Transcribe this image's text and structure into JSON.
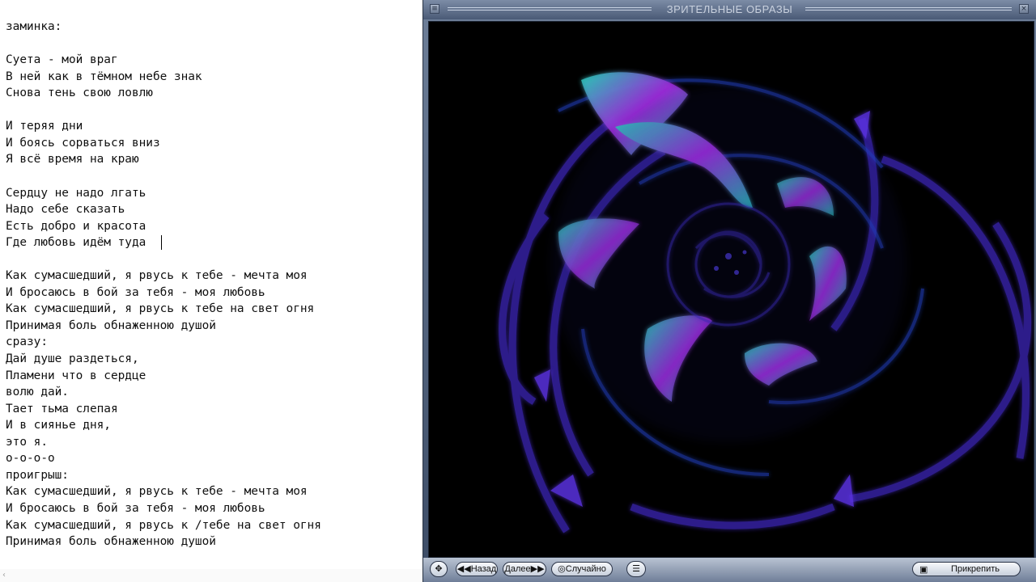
{
  "editor": {
    "lines": [
      "заминка:",
      "",
      "Суета - мой враг",
      "В ней как в тёмном небе знак",
      "Снова тень свою ловлю",
      "",
      "И теряя дни",
      "И боясь сорваться вниз",
      "Я всё время на краю",
      "",
      "Сердцу не надо лгать",
      "Надо себе сказать",
      "Есть добро и красота",
      "Где любовь идём туда",
      "",
      "Как сумасшедший, я рвусь к тебе - мечта моя",
      "И бросаюсь в бой за тебя - моя любовь",
      "Как сумасшедший, я рвусь к тебе на свет огня",
      "Принимая боль обнаженною душой",
      "сразу:",
      "Дай душе раздеться,",
      "Пламени что в сердце",
      "волю дай.",
      "Тает тьма слепая",
      "И в сиянье дня,",
      "это я.",
      "о-о-о-о",
      "проигрыш:",
      "Как сумасшедший, я рвусь к тебе - мечта моя",
      "И бросаюсь в бой за тебя - моя любовь",
      "Как сумасшедший, я рвусь к /тебе на свет огня",
      "Принимая боль обнаженною душой"
    ],
    "scroll_left_icon": "chevron-left-icon"
  },
  "player": {
    "title": "ЗРИТЕЛЬНЫЕ ОБРАЗЫ",
    "controls": {
      "move_icon": "move-arrows-icon",
      "back_label": "◀◀Назад",
      "next_label": "Далее▶▶",
      "random_label": "◎Случайно",
      "menu_icon": "list-menu-icon",
      "attach_label": "Прикрепить",
      "attach_icon": "window-attach-icon"
    },
    "colors": {
      "frame": "#5a6a86",
      "viz_bg": "#000000",
      "viz_purple": "#5a20c8",
      "viz_teal": "#1fb8a8",
      "viz_magenta": "#b020d0"
    }
  }
}
